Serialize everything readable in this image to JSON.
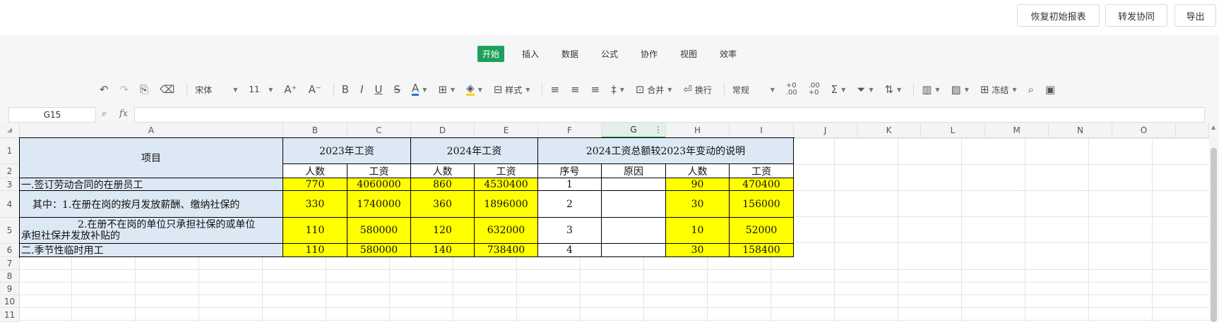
{
  "topbar": {
    "restore_label": "恢复初始报表",
    "forward_label": "转发协同",
    "export_label": "导出"
  },
  "tabs": [
    "开始",
    "插入",
    "数据",
    "公式",
    "协作",
    "视图",
    "效率"
  ],
  "active_tab": "开始",
  "toolbar": {
    "font_name": "宋体",
    "font_size": "11",
    "style_label": "样式",
    "merge_label": "合并",
    "wrap_label": "换行",
    "number_format": "常规",
    "freeze_label": "冻结"
  },
  "formula_bar": {
    "name_box": "G15",
    "fx": "fx",
    "formula": ""
  },
  "selected_column": "G",
  "columns": [
    "A",
    "B",
    "C",
    "D",
    "E",
    "F",
    "G",
    "H",
    "I",
    "J",
    "K",
    "L",
    "M",
    "N",
    "O"
  ],
  "rows": [
    "1",
    "2",
    "3",
    "4",
    "5",
    "6",
    "7",
    "8",
    "9",
    "10",
    "11"
  ],
  "sheet": {
    "header_item": "项目",
    "header_2023": "2023年工资",
    "header_2024": "2024年工资",
    "header_change": "2024工资总额较2023年变动的说明",
    "sub_headers": [
      "人数",
      "工资",
      "人数",
      "工资",
      "序号",
      "原因",
      "人数",
      "工资"
    ],
    "data_rows": [
      {
        "label": "一.签订劳动合同的在册员工",
        "b": "770",
        "c": "4060000",
        "d": "860",
        "e": "4530400",
        "f": "1",
        "g": "",
        "h": "90",
        "i": "470400"
      },
      {
        "label": "其中：1.在册在岗的按月发放薪酬、缴纳社保的",
        "b": "330",
        "c": "1740000",
        "d": "360",
        "e": "1896000",
        "f": "2",
        "g": "",
        "h": "30",
        "i": "156000"
      },
      {
        "label_line1": "2.在册不在岗的单位只承担社保的或单位",
        "label_line2": "承担社保并发放补贴的",
        "b": "110",
        "c": "580000",
        "d": "120",
        "e": "632000",
        "f": "3",
        "g": "",
        "h": "10",
        "i": "52000"
      },
      {
        "label": "二.季节性临时用工",
        "b": "110",
        "c": "580000",
        "d": "140",
        "e": "738400",
        "f": "4",
        "g": "",
        "h": "30",
        "i": "158400"
      }
    ]
  },
  "colors": {
    "accent": "#1fa05a",
    "header_fill": "#dde8f5",
    "highlight_fill": "#ffff00"
  }
}
